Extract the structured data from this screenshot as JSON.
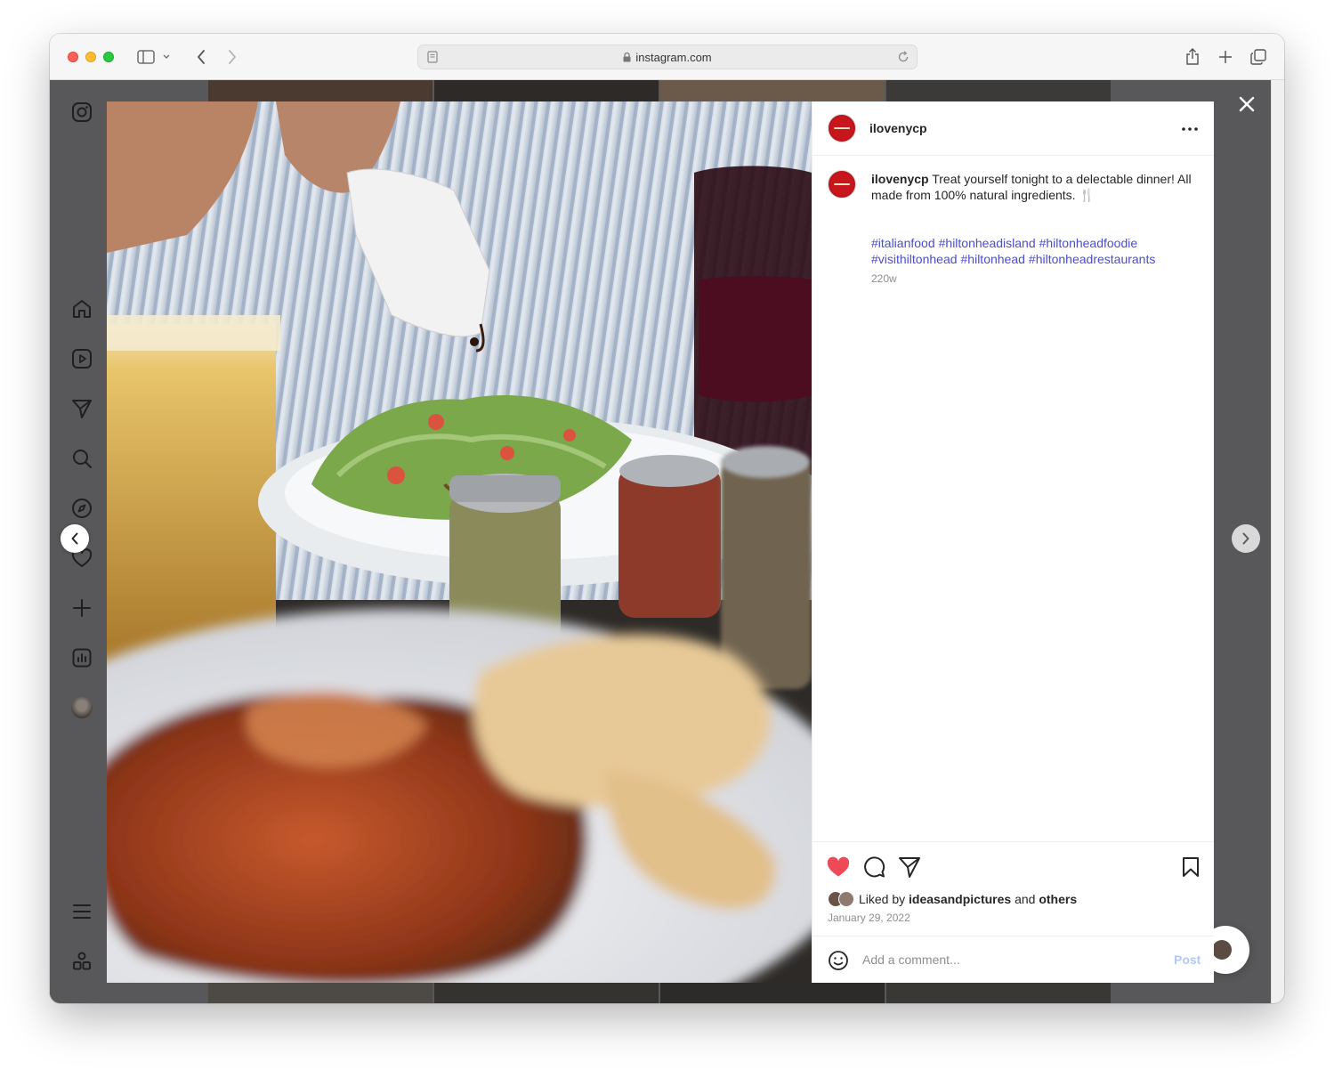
{
  "browser": {
    "url": "instagram.com"
  },
  "post": {
    "username": "ilovenycp",
    "caption_user": "ilovenycp",
    "caption_text": "Treat yourself tonight to a delectable dinner! All made from 100% natural ingredients. 🍴",
    "hashtags": [
      "#italianfood",
      "#hiltonheadisland",
      "#hiltonheadfoodie",
      "#visithiltonhead",
      "#hiltonhead",
      "#hiltonheadrestaurants"
    ],
    "age": "220w",
    "liked_prefix": "Liked by",
    "liked_user": "ideasandpictures",
    "liked_and": "and",
    "liked_others": "others",
    "date": "January 29, 2022",
    "liked": true
  },
  "comment": {
    "placeholder": "Add a comment...",
    "post_label": "Post"
  },
  "colors": {
    "heart": "#ed4956",
    "hashtag": "#4a4dd0",
    "post_disabled": "#b2c8f5",
    "overlay": "#58585a"
  },
  "icons": {
    "sidebar": [
      "instagram-logo-icon",
      "home-icon",
      "reels-icon",
      "direct-icon",
      "search-icon",
      "explore-icon",
      "heart-icon",
      "create-icon",
      "insights-icon",
      "profile-avatar",
      "menu-icon",
      "more-apps-icon"
    ],
    "actions": [
      "heart-icon",
      "comment-icon",
      "share-icon",
      "bookmark-icon"
    ]
  }
}
